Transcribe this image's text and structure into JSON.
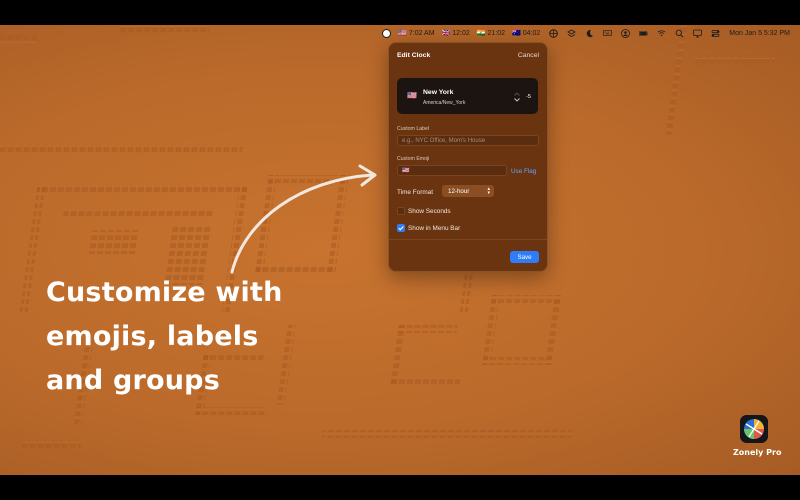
{
  "menubar": {
    "clocks": [
      {
        "flag": "🇺🇸",
        "time": "7:02 AM"
      },
      {
        "flag": "🇬🇧",
        "time": "12:02"
      },
      {
        "flag": "🇮🇳",
        "time": "21:02"
      },
      {
        "flag": "🇦🇺",
        "time": "04:02"
      }
    ],
    "datetime": "Mon Jan 5  5:32 PM"
  },
  "panel": {
    "title": "Edit Clock",
    "cancel": "Cancel",
    "city": {
      "flag": "🇺🇸",
      "name": "New York",
      "timezone": "America/New_York",
      "offset": "-5"
    },
    "custom_label": {
      "label": "Custom Label",
      "placeholder": "e.g., NYC Office, Mom's House"
    },
    "custom_emoji": {
      "label": "Custom Emoji",
      "value": "🇺🇸",
      "use_flag": "Use Flag"
    },
    "time_format": {
      "label": "Time Format",
      "value": "12-hour"
    },
    "show_seconds": {
      "label": "Show Seconds",
      "checked": false
    },
    "show_in_menu_bar": {
      "label": "Show in Menu Bar",
      "checked": true
    },
    "save": "Save"
  },
  "headline": {
    "line1": "Customize with",
    "line2": "emojis, labels",
    "line3": "and groups"
  },
  "app": {
    "name": "Zonely Pro"
  },
  "colors": {
    "wallpaper": "#bb6a2b",
    "panel_bg": "#6a3411",
    "accent": "#2f7cf6",
    "link": "#5fa8ff"
  }
}
